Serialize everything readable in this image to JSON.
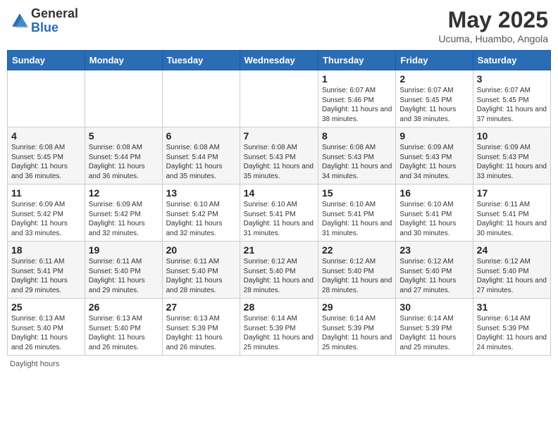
{
  "header": {
    "logo_general": "General",
    "logo_blue": "Blue",
    "main_title": "May 2025",
    "subtitle": "Ucuma, Huambo, Angola"
  },
  "days_of_week": [
    "Sunday",
    "Monday",
    "Tuesday",
    "Wednesday",
    "Thursday",
    "Friday",
    "Saturday"
  ],
  "weeks": [
    [
      {
        "day": "",
        "info": ""
      },
      {
        "day": "",
        "info": ""
      },
      {
        "day": "",
        "info": ""
      },
      {
        "day": "",
        "info": ""
      },
      {
        "day": "1",
        "info": "Sunrise: 6:07 AM\nSunset: 5:46 PM\nDaylight: 11 hours and 38 minutes."
      },
      {
        "day": "2",
        "info": "Sunrise: 6:07 AM\nSunset: 5:45 PM\nDaylight: 11 hours and 38 minutes."
      },
      {
        "day": "3",
        "info": "Sunrise: 6:07 AM\nSunset: 5:45 PM\nDaylight: 11 hours and 37 minutes."
      }
    ],
    [
      {
        "day": "4",
        "info": "Sunrise: 6:08 AM\nSunset: 5:45 PM\nDaylight: 11 hours and 36 minutes."
      },
      {
        "day": "5",
        "info": "Sunrise: 6:08 AM\nSunset: 5:44 PM\nDaylight: 11 hours and 36 minutes."
      },
      {
        "day": "6",
        "info": "Sunrise: 6:08 AM\nSunset: 5:44 PM\nDaylight: 11 hours and 35 minutes."
      },
      {
        "day": "7",
        "info": "Sunrise: 6:08 AM\nSunset: 5:43 PM\nDaylight: 11 hours and 35 minutes."
      },
      {
        "day": "8",
        "info": "Sunrise: 6:08 AM\nSunset: 5:43 PM\nDaylight: 11 hours and 34 minutes."
      },
      {
        "day": "9",
        "info": "Sunrise: 6:09 AM\nSunset: 5:43 PM\nDaylight: 11 hours and 34 minutes."
      },
      {
        "day": "10",
        "info": "Sunrise: 6:09 AM\nSunset: 5:43 PM\nDaylight: 11 hours and 33 minutes."
      }
    ],
    [
      {
        "day": "11",
        "info": "Sunrise: 6:09 AM\nSunset: 5:42 PM\nDaylight: 11 hours and 33 minutes."
      },
      {
        "day": "12",
        "info": "Sunrise: 6:09 AM\nSunset: 5:42 PM\nDaylight: 11 hours and 32 minutes."
      },
      {
        "day": "13",
        "info": "Sunrise: 6:10 AM\nSunset: 5:42 PM\nDaylight: 11 hours and 32 minutes."
      },
      {
        "day": "14",
        "info": "Sunrise: 6:10 AM\nSunset: 5:41 PM\nDaylight: 11 hours and 31 minutes."
      },
      {
        "day": "15",
        "info": "Sunrise: 6:10 AM\nSunset: 5:41 PM\nDaylight: 11 hours and 31 minutes."
      },
      {
        "day": "16",
        "info": "Sunrise: 6:10 AM\nSunset: 5:41 PM\nDaylight: 11 hours and 30 minutes."
      },
      {
        "day": "17",
        "info": "Sunrise: 6:11 AM\nSunset: 5:41 PM\nDaylight: 11 hours and 30 minutes."
      }
    ],
    [
      {
        "day": "18",
        "info": "Sunrise: 6:11 AM\nSunset: 5:41 PM\nDaylight: 11 hours and 29 minutes."
      },
      {
        "day": "19",
        "info": "Sunrise: 6:11 AM\nSunset: 5:40 PM\nDaylight: 11 hours and 29 minutes."
      },
      {
        "day": "20",
        "info": "Sunrise: 6:11 AM\nSunset: 5:40 PM\nDaylight: 11 hours and 28 minutes."
      },
      {
        "day": "21",
        "info": "Sunrise: 6:12 AM\nSunset: 5:40 PM\nDaylight: 11 hours and 28 minutes."
      },
      {
        "day": "22",
        "info": "Sunrise: 6:12 AM\nSunset: 5:40 PM\nDaylight: 11 hours and 28 minutes."
      },
      {
        "day": "23",
        "info": "Sunrise: 6:12 AM\nSunset: 5:40 PM\nDaylight: 11 hours and 27 minutes."
      },
      {
        "day": "24",
        "info": "Sunrise: 6:12 AM\nSunset: 5:40 PM\nDaylight: 11 hours and 27 minutes."
      }
    ],
    [
      {
        "day": "25",
        "info": "Sunrise: 6:13 AM\nSunset: 5:40 PM\nDaylight: 11 hours and 26 minutes."
      },
      {
        "day": "26",
        "info": "Sunrise: 6:13 AM\nSunset: 5:40 PM\nDaylight: 11 hours and 26 minutes."
      },
      {
        "day": "27",
        "info": "Sunrise: 6:13 AM\nSunset: 5:39 PM\nDaylight: 11 hours and 26 minutes."
      },
      {
        "day": "28",
        "info": "Sunrise: 6:14 AM\nSunset: 5:39 PM\nDaylight: 11 hours and 25 minutes."
      },
      {
        "day": "29",
        "info": "Sunrise: 6:14 AM\nSunset: 5:39 PM\nDaylight: 11 hours and 25 minutes."
      },
      {
        "day": "30",
        "info": "Sunrise: 6:14 AM\nSunset: 5:39 PM\nDaylight: 11 hours and 25 minutes."
      },
      {
        "day": "31",
        "info": "Sunrise: 6:14 AM\nSunset: 5:39 PM\nDaylight: 11 hours and 24 minutes."
      }
    ]
  ],
  "footer": {
    "daylight_label": "Daylight hours"
  }
}
